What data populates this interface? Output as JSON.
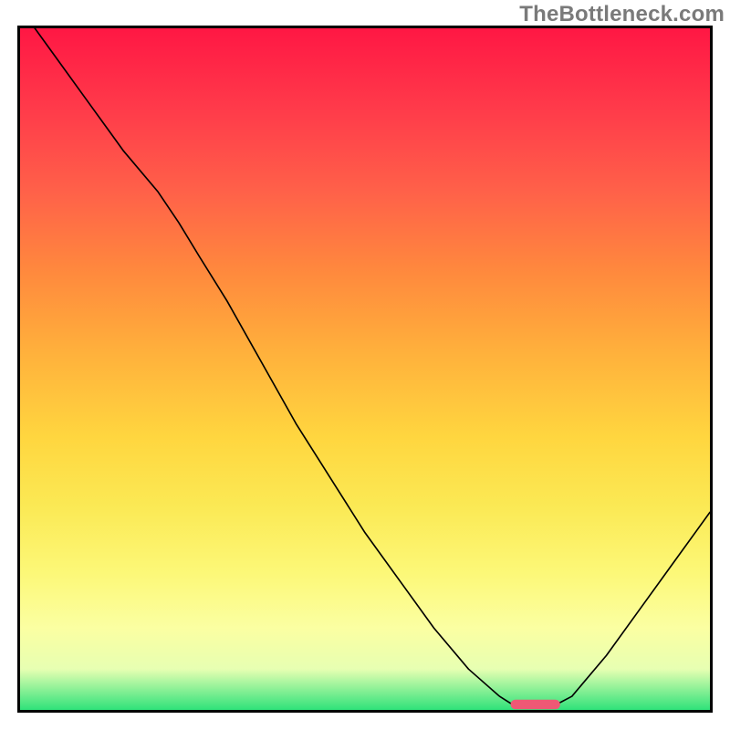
{
  "watermark": "TheBottleneck.com",
  "chart_data": {
    "type": "line",
    "title": "",
    "xlabel": "",
    "ylabel": "",
    "x": [
      0.0,
      0.05,
      0.1,
      0.15,
      0.2,
      0.25,
      0.3,
      0.35,
      0.4,
      0.45,
      0.5,
      0.55,
      0.6,
      0.65,
      0.7,
      0.72,
      0.77,
      0.8,
      0.85,
      0.9,
      0.95,
      1.0
    ],
    "values": [
      1.03,
      0.96,
      0.89,
      0.82,
      0.76,
      0.7,
      0.6,
      0.51,
      0.42,
      0.34,
      0.26,
      0.19,
      0.12,
      0.06,
      0.02,
      0.0,
      0.0,
      0.02,
      0.08,
      0.15,
      0.22,
      0.29
    ],
    "ylim": [
      0,
      1
    ],
    "xlim": [
      0,
      1
    ],
    "optimal_marker": {
      "x_start": 0.715,
      "x_end": 0.775,
      "y": 0.005
    },
    "background_gradient": {
      "stops": [
        {
          "pos": 0.0,
          "color": "#ff1744"
        },
        {
          "pos": 0.5,
          "color": "#ffb23c"
        },
        {
          "pos": 0.85,
          "color": "#fcf878"
        },
        {
          "pos": 1.0,
          "color": "#2fe27a"
        }
      ],
      "direction": "top-to-bottom"
    },
    "note": "Axes are unlabeled in the source image; x and y normalized 0–1. Curve rises steeply from top-left, bends near x≈0.23, descends to a flat minimum around x≈0.72–0.78 (green zone), then rises again toward the right edge."
  }
}
